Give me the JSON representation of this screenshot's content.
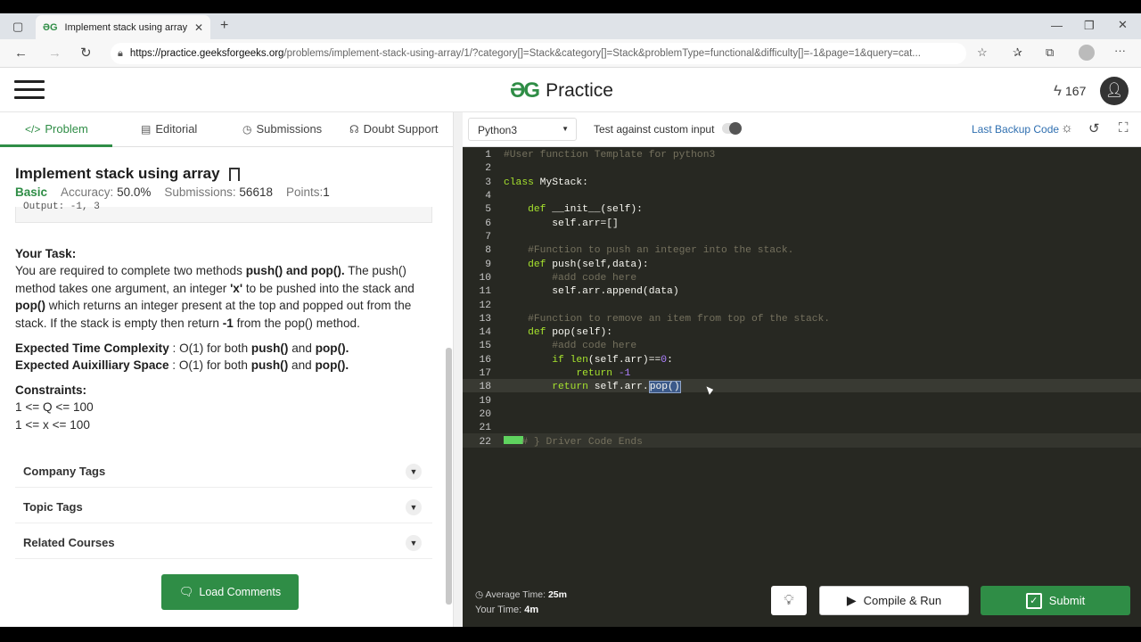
{
  "browser": {
    "tab_title": "Implement stack using array | Pr",
    "url_host": "https://practice.geeksforgeeks.org",
    "url_path": "/problems/implement-stack-using-array/1/?category[]=Stack&category[]=Stack&problemType=functional&difficulty[]=-1&page=1&query=cat..."
  },
  "site": {
    "logo_text": "Practice",
    "streak": "167"
  },
  "left_tabs": [
    "Problem",
    "Editorial",
    "Submissions",
    "Doubt Support"
  ],
  "problem": {
    "title": "Implement stack using array",
    "difficulty": "Basic",
    "accuracy_label": "Accuracy:",
    "accuracy": "50.0%",
    "submissions_label": "Submissions:",
    "submissions": "56618",
    "points_label": "Points:",
    "points": "1",
    "code_snip": "Output:  -1, 3",
    "task_heading": "Your Task:",
    "task_p1": "You are required to complete two methods ",
    "task_b1": "push() and pop().",
    "task_p2": " The push() method takes one argument, an integer ",
    "task_b2": "'x'",
    "task_p3": " to be pushed into the stack and ",
    "task_b3": "pop()",
    "task_p4": " which returns an integer present at the top and popped out from the stack. If the stack is empty then return ",
    "task_b4": "-1",
    "task_p5": " from the pop() method.",
    "etc_label": "Expected Time Complexity",
    "etc_text": " : O(1) for both ",
    "eas_label": "Expected Auixilliary Space",
    "eas_text": " : O(1) for both ",
    "push": "push()",
    "and": " and ",
    "pop": "pop().",
    "constraints_heading": "Constraints:",
    "constraint1": "1 <= Q <= 100",
    "constraint2": "1 <= x <= 100"
  },
  "accordions": [
    "Company Tags",
    "Topic Tags",
    "Related Courses"
  ],
  "load_comments": "Load Comments",
  "editor_header": {
    "language": "Python3",
    "custom_input": "Test against custom input",
    "backup": "Last Backup Code"
  },
  "code_lines": [
    "#User function Template for python3",
    "",
    "class MyStack:",
    "",
    "    def __init__(self):",
    "        self.arr=[]",
    "",
    "    #Function to push an integer into the stack.",
    "    def push(self,data):",
    "        #add code here",
    "        self.arr.append(data)",
    "",
    "    #Function to remove an item from top of the stack.",
    "    def pop(self):",
    "        #add code here",
    "        if len(self.arr)==0:",
    "            return -1",
    "        return self.arr.pop()",
    "",
    "",
    "",
    "# } Driver Code Ends"
  ],
  "footer": {
    "avg_label": "Average Time:",
    "avg_value": "25m",
    "your_label": "Your Time:",
    "your_value": "4m",
    "compile": "Compile & Run",
    "submit": "Submit"
  },
  "colors": {
    "brand_green": "#2f8d46",
    "editor_bg": "#272822"
  }
}
